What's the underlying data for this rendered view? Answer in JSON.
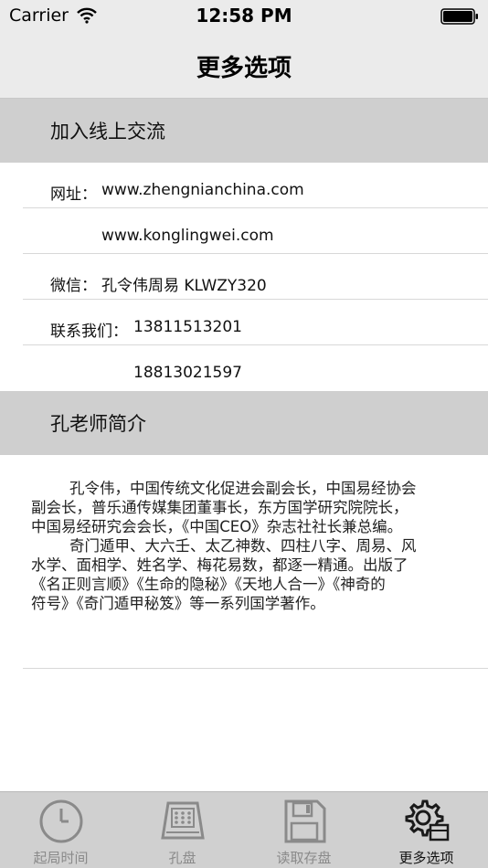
{
  "status_bar": {
    "carrier": "Carrier",
    "time": "12:58 PM"
  },
  "nav": {
    "title": "更多选项"
  },
  "online": {
    "header": "加入线上交流",
    "website_label": "网址：",
    "website_1": "www.zhengnianchina.com",
    "website_2": "www.konglingwei.com",
    "wechat_label": "微信：",
    "wechat_value": "孔令伟周易 KLWZY320",
    "contact_label": "联系我们：",
    "phone_1": "13811513201",
    "phone_2": "18813021597"
  },
  "intro": {
    "header": "孔老师简介",
    "lines": [
      "        孔令伟，中国传统文化促进会副会长，中国易经协会",
      "副会长，普乐通传媒集团董事长，东方国学研究院院长，",
      "中国易经研究会会长，《中国CEO》杂志社社长兼总编。",
      "        奇门遁甲、大六壬、太乙神数、四柱八字、周易、风",
      "水学、面相学、姓名学、梅花易数，都逐一精通。出版了",
      "《名正则言顺》《生命的隐秘》《天地人合一》《神奇的",
      "符号》《奇门遁甲秘笈》等一系列国学著作。"
    ]
  },
  "tabs": [
    {
      "label": "起局时间",
      "icon": "clock-icon",
      "active": false
    },
    {
      "label": "孔盘",
      "icon": "board-icon",
      "active": false
    },
    {
      "label": "读取存盘",
      "icon": "save-disk-icon",
      "active": false
    },
    {
      "label": "更多选项",
      "icon": "gear-icon",
      "active": true
    }
  ],
  "colors": {
    "tab_active": "#111111",
    "tab_inactive": "#8a8a8a",
    "section_bg": "#cfcfcf"
  }
}
